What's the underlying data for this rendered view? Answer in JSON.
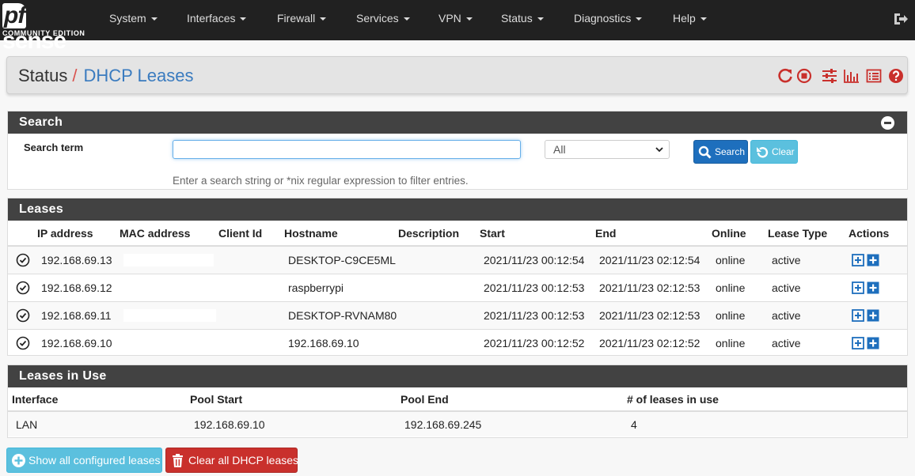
{
  "brand": {
    "name_pf": "pf",
    "name_rest": "sense",
    "edition": "COMMUNITY EDITION"
  },
  "nav": {
    "items": [
      {
        "label": "System"
      },
      {
        "label": "Interfaces"
      },
      {
        "label": "Firewall"
      },
      {
        "label": "Services"
      },
      {
        "label": "VPN"
      },
      {
        "label": "Status"
      },
      {
        "label": "Diagnostics"
      },
      {
        "label": "Help"
      }
    ]
  },
  "breadcrumb": {
    "parent": "Status",
    "separator": "/",
    "current": "DHCP Leases"
  },
  "header_icons": [
    "refresh-icon",
    "stop-icon",
    "sliders-icon",
    "bar-chart-icon",
    "list-icon",
    "help-icon"
  ],
  "search": {
    "title": "Search",
    "term_label": "Search term",
    "input_value": "",
    "select_value": "All",
    "help": "Enter a search string or *nix regular expression to filter entries.",
    "search_label": "Search",
    "clear_label": "Clear"
  },
  "leases": {
    "title": "Leases",
    "columns": {
      "ip": "IP address",
      "mac": "MAC address",
      "client_id": "Client Id",
      "hostname": "Hostname",
      "description": "Description",
      "start": "Start",
      "end": "End",
      "online": "Online",
      "lease_type": "Lease Type",
      "actions": "Actions"
    },
    "rows": [
      {
        "ip": "192.168.69.13",
        "mac": "",
        "client_id": "",
        "hostname": "DESKTOP-C9CE5ML",
        "description": "",
        "start": "2021/11/23 00:12:54",
        "end": "2021/11/23 02:12:54",
        "online": "online",
        "lease_type": "active"
      },
      {
        "ip": "192.168.69.12",
        "mac": "",
        "client_id": "",
        "hostname": "raspberrypi",
        "description": "",
        "start": "2021/11/23 00:12:53",
        "end": "2021/11/23 02:12:53",
        "online": "online",
        "lease_type": "active"
      },
      {
        "ip": "192.168.69.11",
        "mac": "",
        "client_id": "",
        "hostname": "DESKTOP-RVNAM80",
        "description": "",
        "start": "2021/11/23 00:12:53",
        "end": "2021/11/23 02:12:53",
        "online": "online",
        "lease_type": "active"
      },
      {
        "ip": "192.168.69.10",
        "mac": "",
        "client_id": "",
        "hostname": "192.168.69.10",
        "description": "",
        "start": "2021/11/23 00:12:52",
        "end": "2021/11/23 02:12:52",
        "online": "online",
        "lease_type": "active"
      }
    ]
  },
  "leases_in_use": {
    "title": "Leases in Use",
    "columns": {
      "interface": "Interface",
      "pool_start": "Pool Start",
      "pool_end": "Pool End",
      "count": "# of leases in use"
    },
    "rows": [
      {
        "interface": "LAN",
        "pool_start": "192.168.69.10",
        "pool_end": "192.168.69.245",
        "count": "4"
      }
    ]
  },
  "actions": {
    "show_all": "Show all configured leases",
    "clear_all": "Clear all DHCP leases"
  },
  "colors": {
    "navbar": "#212121",
    "panel_head": "#424242",
    "accent_red": "#c9302c",
    "link_blue": "#3a7bbf",
    "info": "#5bc0de",
    "primary": "#1e6fbd"
  }
}
